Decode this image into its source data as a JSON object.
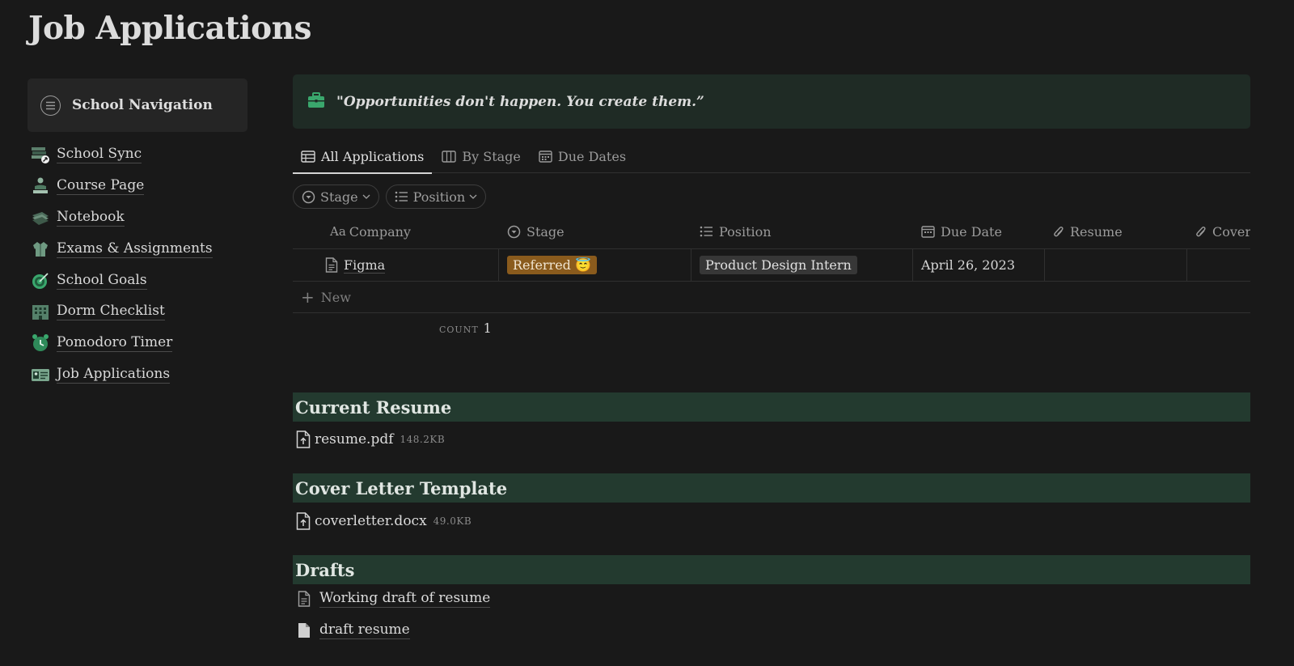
{
  "page": {
    "title": "Job Applications"
  },
  "sidebar": {
    "header": "School Navigation",
    "items": [
      {
        "label": "School Sync",
        "icon": "books-sync-icon"
      },
      {
        "label": "Course Page",
        "icon": "person-reading-icon"
      },
      {
        "label": "Notebook",
        "icon": "notebook-icon"
      },
      {
        "label": "Exams & Assignments",
        "icon": "coat-icon"
      },
      {
        "label": "School Goals",
        "icon": "target-icon"
      },
      {
        "label": "Dorm Checklist",
        "icon": "building-icon"
      },
      {
        "label": "Pomodoro Timer",
        "icon": "alarm-clock-icon"
      },
      {
        "label": "Job Applications",
        "icon": "id-card-icon"
      }
    ]
  },
  "callout": {
    "text": "\"Opportunities don't happen. You create them.”",
    "icon": "briefcase-icon"
  },
  "tabs": [
    {
      "label": "All Applications",
      "active": true
    },
    {
      "label": "By Stage",
      "active": false
    },
    {
      "label": "Due Dates",
      "active": false
    }
  ],
  "filters": [
    {
      "label": "Stage"
    },
    {
      "label": "Position"
    }
  ],
  "table": {
    "columns": [
      "Company",
      "Stage",
      "Position",
      "Due Date",
      "Resume",
      "Cover"
    ],
    "rows": [
      {
        "company": "Figma",
        "stage": "Referred 😇",
        "position": "Product Design Intern",
        "due_date": "April 26, 2023",
        "resume": "",
        "cover": ""
      }
    ],
    "new_label": "New",
    "count_label": "COUNT",
    "count_value": "1"
  },
  "sections": {
    "resume": {
      "title": "Current Resume",
      "file": "resume.pdf",
      "size": "148.2KB"
    },
    "cover": {
      "title": "Cover Letter Template",
      "file": "coverletter.docx",
      "size": "49.0KB"
    },
    "drafts": {
      "title": "Drafts",
      "items": [
        "Working draft of resume",
        "draft resume"
      ]
    }
  },
  "colors": {
    "background": "#191919",
    "callout": "#1f2b25",
    "section": "#233a2f",
    "accent_green": "#3aa76d",
    "tag_orange": "#8a5b1d"
  }
}
